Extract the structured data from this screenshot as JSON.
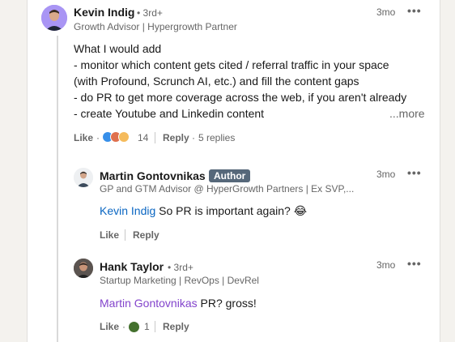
{
  "comment": {
    "author": "Kevin Indig",
    "degree": "3rd+",
    "headline": "Growth Advisor | Hypergrowth Partner",
    "time": "3mo",
    "lines": [
      "What I would add",
      "- monitor which content gets cited / referral traffic in your space",
      "(with Profound, Scrunch AI, etc.) and fill the content gaps",
      "- do PR to get more coverage across the web, if you aren't already",
      "- create Youtube and Linkedin content"
    ],
    "see_more": "...more",
    "like_label": "Like",
    "reaction_count": "14",
    "reply_label": "Reply",
    "replies_count": "5 replies",
    "reactions": [
      "like",
      "love",
      "celebrate"
    ]
  },
  "replies": [
    {
      "author": "Martin Gontovnikas",
      "badge": "Author",
      "headline": "GP and GTM Advisor @ HyperGrowth Partners | Ex SVP,...",
      "time": "3mo",
      "mention": "Kevin Indig",
      "text": " So PR is important again? 😂",
      "like_label": "Like",
      "reply_label": "Reply"
    },
    {
      "author": "Hank Taylor",
      "degree": "3rd+",
      "headline": "Startup Marketing | RevOps | DevRel",
      "time": "3mo",
      "mention": "Martin Gontovnikas",
      "text": " PR? gross!",
      "like_label": "Like",
      "reaction_count": "1",
      "reply_label": "Reply",
      "reactions": [
        "funny"
      ]
    }
  ],
  "colors": {
    "mention_blue": "#0a66c2",
    "mention_purple": "#8344cc",
    "badge": "#56687a"
  }
}
